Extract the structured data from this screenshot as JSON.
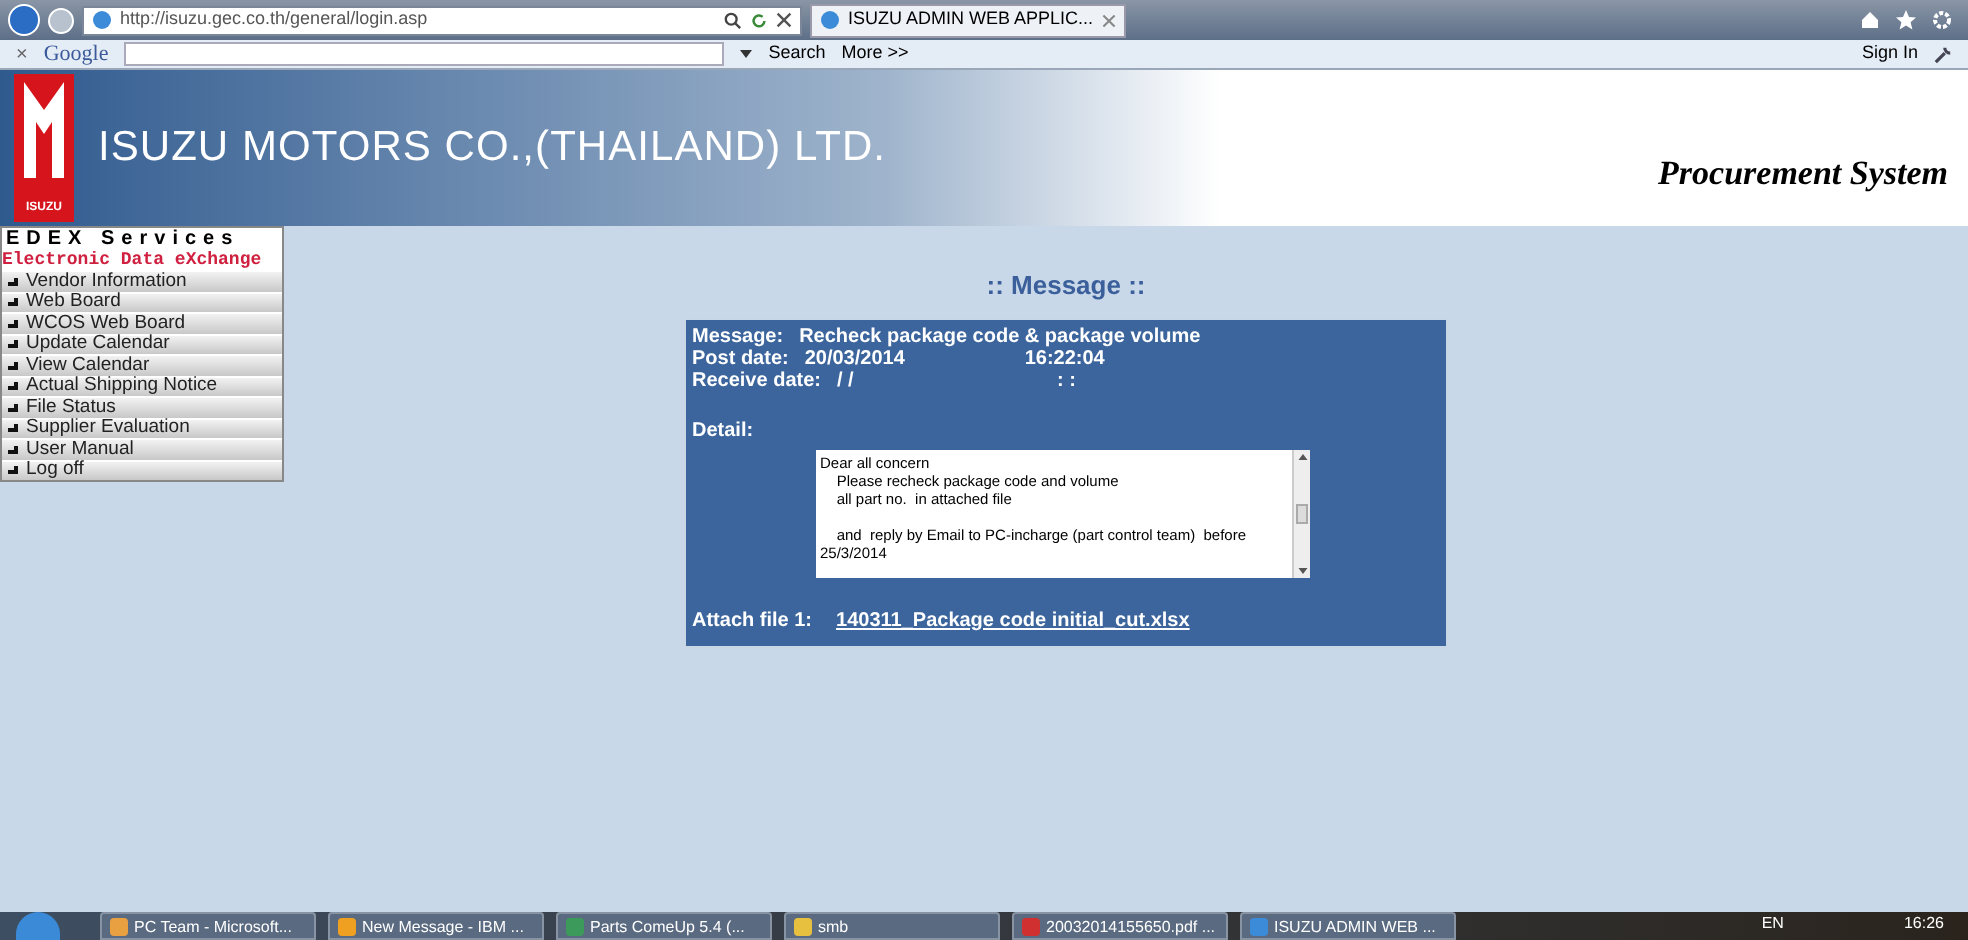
{
  "browser": {
    "url": "http://isuzu.gec.co.th/general/login.asp",
    "tab_title": "ISUZU ADMIN WEB APPLIC...",
    "toolbar_close": "×",
    "search_brand": "Google",
    "search_button": "Search",
    "more": "More >>",
    "sign_in": "Sign In"
  },
  "header": {
    "company": "ISUZU MOTORS CO.,(THAILAND) LTD.",
    "logo_text": "ISUZU",
    "system": "Procurement System"
  },
  "sidebar": {
    "title": "EDEX Services",
    "subtitle": "Electronic Data eXchange",
    "items": [
      {
        "label": "Vendor Information"
      },
      {
        "label": "Web Board"
      },
      {
        "label": "WCOS Web Board"
      },
      {
        "label": "Update Calendar"
      },
      {
        "label": "View Calendar"
      },
      {
        "label": "Actual Shipping Notice"
      },
      {
        "label": "File Status"
      },
      {
        "label": "Supplier Evaluation"
      },
      {
        "label": "User Manual"
      },
      {
        "label": "Log off"
      }
    ]
  },
  "message": {
    "heading": ":: Message ::",
    "fields": [
      {
        "label": "Message:",
        "value": "Recheck package code & package volume"
      },
      {
        "label": "Post date:",
        "value": "20/03/2014",
        "extra": "16:22:04"
      },
      {
        "label": "Receive date:",
        "value": "/ /",
        "extra": ": :"
      }
    ],
    "detail_label": "Detail:",
    "detail_text": "Dear all concern\n    Please recheck package code and volume\n    all part no.  in attached file\n\n    and  reply by Email to PC-incharge (part control team)  before\n25/3/2014",
    "attach_label": "Attach file 1:",
    "attach_file": "140311_Package code initial_cut.xlsx"
  },
  "taskbar": {
    "items": [
      {
        "label": "PC Team - Microsoft...",
        "kind": "mail"
      },
      {
        "label": "New Message - IBM ...",
        "kind": "chat"
      },
      {
        "label": "Parts ComeUp 5.4 (...",
        "kind": "app"
      },
      {
        "label": "smb",
        "kind": "folder"
      },
      {
        "label": "20032014155650.pdf ...",
        "kind": "pdf"
      },
      {
        "label": "ISUZU ADMIN WEB ...",
        "kind": "browser"
      }
    ],
    "language": "EN",
    "clock": "16:26"
  }
}
